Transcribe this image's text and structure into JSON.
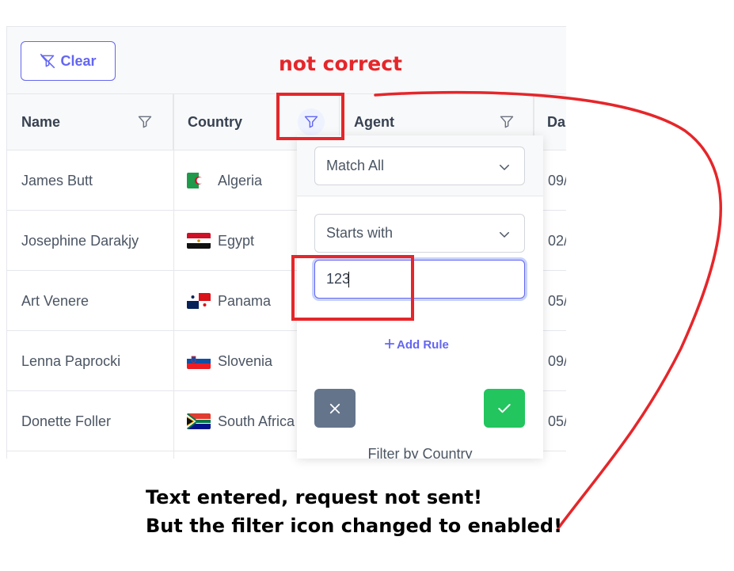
{
  "toolbar": {
    "clear_label": "Clear"
  },
  "columns": [
    {
      "label": "Name"
    },
    {
      "label": "Country"
    },
    {
      "label": "Agent"
    },
    {
      "label": "Da"
    }
  ],
  "rows": [
    {
      "name": "James Butt",
      "country": "Algeria",
      "flag": "algeria",
      "date": "09/"
    },
    {
      "name": "Josephine Darakjy",
      "country": "Egypt",
      "flag": "egypt",
      "date": "02/"
    },
    {
      "name": "Art Venere",
      "country": "Panama",
      "flag": "panama",
      "date": "05/"
    },
    {
      "name": "Lenna Paprocki",
      "country": "Slovenia",
      "flag": "slovenia",
      "date": "09/"
    },
    {
      "name": "Donette Foller",
      "country": "South Africa",
      "flag": "south-africa",
      "date": "05/"
    }
  ],
  "filter_overlay": {
    "operator": "Match All",
    "match_mode": "Starts with",
    "input_value": "123",
    "add_rule_label": "Add Rule",
    "footer": "Filter by Country"
  },
  "annotations": {
    "title": "not correct",
    "caption_line1": "Text entered, request not sent!",
    "caption_line2": "But the filter icon changed to enabled!"
  },
  "colors": {
    "accent": "#6366f1",
    "annotation_red": "#e5262a",
    "apply_green": "#22c55e",
    "clear_slate": "#64748b"
  },
  "icons": {
    "filter": "funnel-icon",
    "clear": "filter-slash-icon",
    "dropdown": "chevron-down-icon",
    "cancel": "close-icon",
    "apply": "check-icon",
    "add": "plus-icon"
  }
}
